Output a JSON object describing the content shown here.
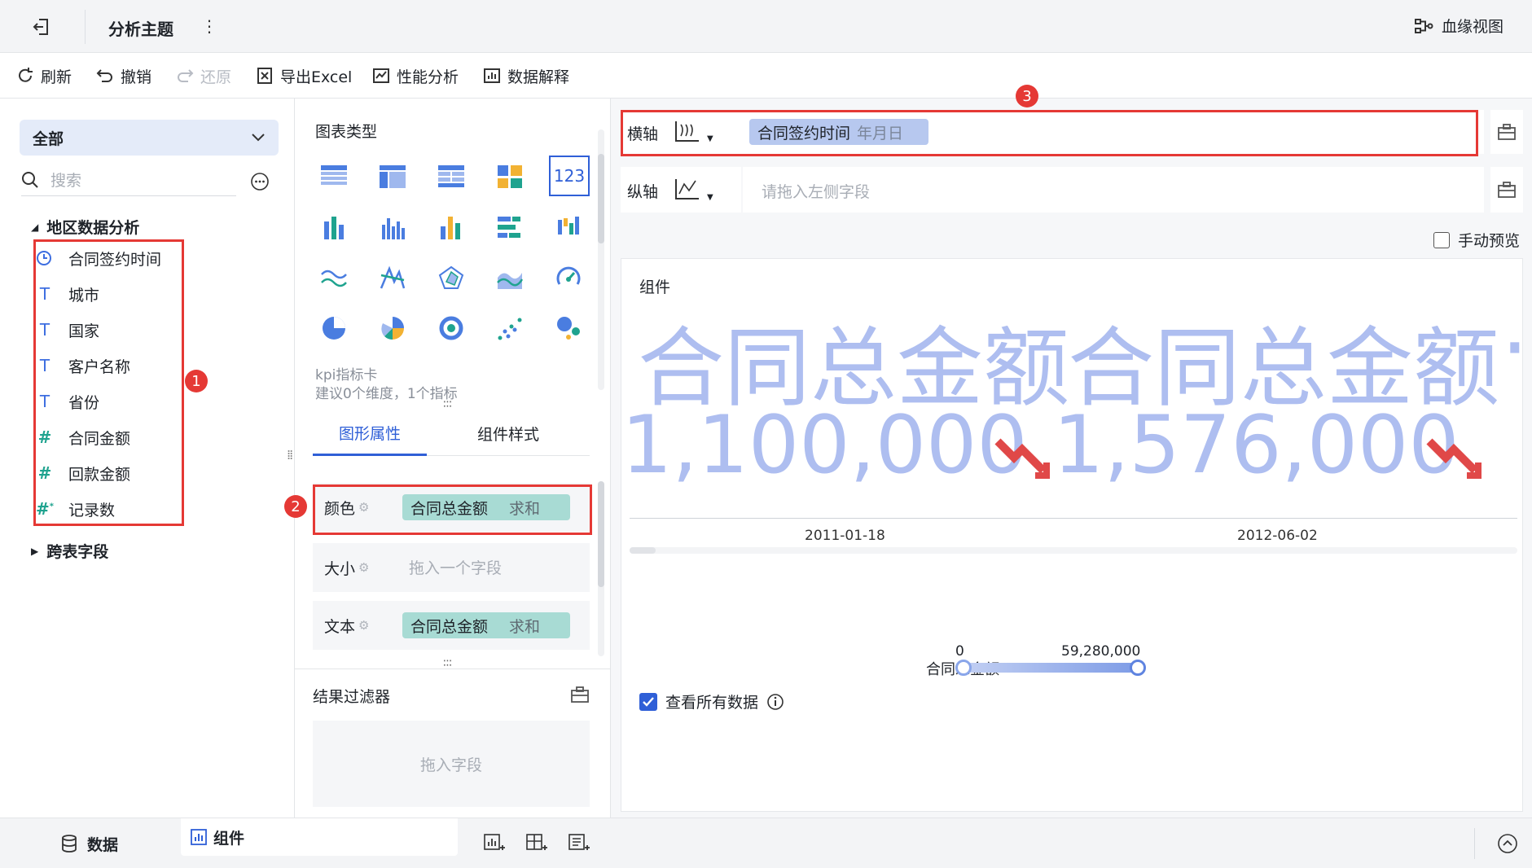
{
  "header": {
    "title": "分析主题",
    "lineage_label": "血缘视图"
  },
  "toolbar": {
    "refresh": "刷新",
    "undo": "撤销",
    "redo": "还原",
    "export": "导出Excel",
    "perf": "性能分析",
    "explain": "数据解释"
  },
  "left": {
    "scope": "全部",
    "search_placeholder": "搜索",
    "group_title": "地区数据分析",
    "fields": [
      {
        "label": "合同签约时间",
        "type": "date"
      },
      {
        "label": "城市",
        "type": "text"
      },
      {
        "label": "国家",
        "type": "text"
      },
      {
        "label": "客户名称",
        "type": "text"
      },
      {
        "label": "省份",
        "type": "text"
      },
      {
        "label": "合同金额",
        "type": "number"
      },
      {
        "label": "回款金额",
        "type": "number"
      },
      {
        "label": "记录数",
        "type": "count"
      }
    ],
    "cross_table": "跨表字段"
  },
  "badges": {
    "one": "1",
    "two": "2",
    "three": "3"
  },
  "mid": {
    "chart_types_title": "图表类型",
    "kpi_name": "kpi指标卡",
    "kpi_hint": "建议0个维度，1个指标",
    "tab_props": "图形属性",
    "tab_style": "组件样式",
    "color_label": "颜色",
    "size_label": "大小",
    "text_label": "文本",
    "color_field": "合同总金额",
    "color_agg": "求和",
    "size_placeholder": "拖入一个字段",
    "text_field": "合同总金额",
    "text_agg": "求和",
    "filter_title": "结果过滤器",
    "filter_placeholder": "拖入字段"
  },
  "right": {
    "x_axis_label": "横轴",
    "x_field": "合同签约时间",
    "x_field_grain": "年月日",
    "y_axis_label": "纵轴",
    "y_placeholder": "请拖入左侧字段",
    "manual_preview": "手动预览",
    "component_title": "组件",
    "kpi_titles": [
      "合同总金额",
      "合同总金额"
    ],
    "kpi_values": [
      "1,100,000",
      "1,576,000"
    ],
    "dates": [
      "2011-01-18",
      "2012-06-02"
    ],
    "legend_label": "合同总金额",
    "legend_min": "0",
    "legend_max": "59,280,000",
    "view_all": "查看所有数据"
  },
  "bottom": {
    "data_tab": "数据",
    "component_tab": "组件"
  },
  "colors": {
    "accent": "#2f5fd7",
    "kpi_text": "#aebef0",
    "trend_down": "#e04848",
    "pill_teal": "#a8dbd4",
    "pill_blue": "#b7c8ef",
    "red_annotation": "#e53935"
  }
}
